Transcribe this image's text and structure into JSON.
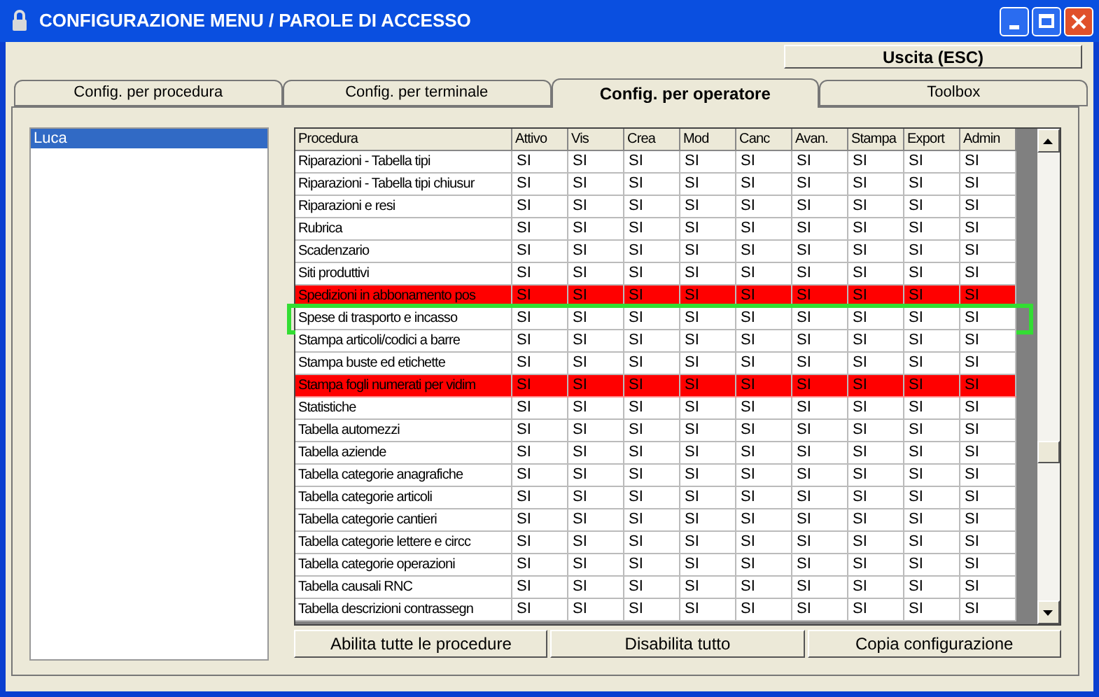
{
  "window": {
    "title": "CONFIGURAZIONE MENU / PAROLE DI ACCESSO"
  },
  "exit_button": "Uscita (ESC)",
  "tabs": [
    {
      "label": "Config. per procedura",
      "selected": false
    },
    {
      "label": "Config. per terminale",
      "selected": false
    },
    {
      "label": "Config. per operatore",
      "selected": true
    },
    {
      "label": "Toolbox",
      "selected": false
    }
  ],
  "operators": [
    {
      "name": "Luca",
      "selected": true
    }
  ],
  "table": {
    "columns": [
      "Procedura",
      "Attivo",
      "Vis",
      "Crea",
      "Mod",
      "Canc",
      "Avan.",
      "Stampa",
      "Export",
      "Admin"
    ],
    "rows": [
      {
        "cells": [
          "Riparazioni - Tabella tipi",
          "SI",
          "SI",
          "SI",
          "SI",
          "SI",
          "SI",
          "SI",
          "SI",
          "SI"
        ],
        "flagged": false,
        "selected": false
      },
      {
        "cells": [
          "Riparazioni - Tabella tipi chiusur",
          "SI",
          "SI",
          "SI",
          "SI",
          "SI",
          "SI",
          "SI",
          "SI",
          "SI"
        ],
        "flagged": false,
        "selected": false
      },
      {
        "cells": [
          "Riparazioni e resi",
          "SI",
          "SI",
          "SI",
          "SI",
          "SI",
          "SI",
          "SI",
          "SI",
          "SI"
        ],
        "flagged": false,
        "selected": false
      },
      {
        "cells": [
          "Rubrica",
          "SI",
          "SI",
          "SI",
          "SI",
          "SI",
          "SI",
          "SI",
          "SI",
          "SI"
        ],
        "flagged": false,
        "selected": false
      },
      {
        "cells": [
          "Scadenzario",
          "SI",
          "SI",
          "SI",
          "SI",
          "SI",
          "SI",
          "SI",
          "SI",
          "SI"
        ],
        "flagged": false,
        "selected": false
      },
      {
        "cells": [
          "Siti produttivi",
          "SI",
          "SI",
          "SI",
          "SI",
          "SI",
          "SI",
          "SI",
          "SI",
          "SI"
        ],
        "flagged": false,
        "selected": false
      },
      {
        "cells": [
          "Spedizioni in abbonamento pos",
          "SI",
          "SI",
          "SI",
          "SI",
          "SI",
          "SI",
          "SI",
          "SI",
          "SI"
        ],
        "flagged": true,
        "selected": false
      },
      {
        "cells": [
          "Spese di trasporto e incasso",
          "SI",
          "SI",
          "SI",
          "SI",
          "SI",
          "SI",
          "SI",
          "SI",
          "SI"
        ],
        "flagged": false,
        "selected": true
      },
      {
        "cells": [
          "Stampa articoli/codici a barre",
          "SI",
          "SI",
          "SI",
          "SI",
          "SI",
          "SI",
          "SI",
          "SI",
          "SI"
        ],
        "flagged": false,
        "selected": false
      },
      {
        "cells": [
          "Stampa buste ed etichette",
          "SI",
          "SI",
          "SI",
          "SI",
          "SI",
          "SI",
          "SI",
          "SI",
          "SI"
        ],
        "flagged": false,
        "selected": false
      },
      {
        "cells": [
          "Stampa fogli numerati per vidim",
          "SI",
          "SI",
          "SI",
          "SI",
          "SI",
          "SI",
          "SI",
          "SI",
          "SI"
        ],
        "flagged": true,
        "selected": false
      },
      {
        "cells": [
          "Statistiche",
          "SI",
          "SI",
          "SI",
          "SI",
          "SI",
          "SI",
          "SI",
          "SI",
          "SI"
        ],
        "flagged": false,
        "selected": false
      },
      {
        "cells": [
          "Tabella automezzi",
          "SI",
          "SI",
          "SI",
          "SI",
          "SI",
          "SI",
          "SI",
          "SI",
          "SI"
        ],
        "flagged": false,
        "selected": false
      },
      {
        "cells": [
          "Tabella aziende",
          "SI",
          "SI",
          "SI",
          "SI",
          "SI",
          "SI",
          "SI",
          "SI",
          "SI"
        ],
        "flagged": false,
        "selected": false
      },
      {
        "cells": [
          "Tabella categorie anagrafiche",
          "SI",
          "SI",
          "SI",
          "SI",
          "SI",
          "SI",
          "SI",
          "SI",
          "SI"
        ],
        "flagged": false,
        "selected": false
      },
      {
        "cells": [
          "Tabella categorie articoli",
          "SI",
          "SI",
          "SI",
          "SI",
          "SI",
          "SI",
          "SI",
          "SI",
          "SI"
        ],
        "flagged": false,
        "selected": false
      },
      {
        "cells": [
          "Tabella categorie cantieri",
          "SI",
          "SI",
          "SI",
          "SI",
          "SI",
          "SI",
          "SI",
          "SI",
          "SI"
        ],
        "flagged": false,
        "selected": false
      },
      {
        "cells": [
          "Tabella categorie lettere e circc",
          "SI",
          "SI",
          "SI",
          "SI",
          "SI",
          "SI",
          "SI",
          "SI",
          "SI"
        ],
        "flagged": false,
        "selected": false
      },
      {
        "cells": [
          "Tabella categorie operazioni",
          "SI",
          "SI",
          "SI",
          "SI",
          "SI",
          "SI",
          "SI",
          "SI",
          "SI"
        ],
        "flagged": false,
        "selected": false
      },
      {
        "cells": [
          "Tabella causali RNC",
          "SI",
          "SI",
          "SI",
          "SI",
          "SI",
          "SI",
          "SI",
          "SI",
          "SI"
        ],
        "flagged": false,
        "selected": false
      },
      {
        "cells": [
          "Tabella descrizioni contrassegn",
          "SI",
          "SI",
          "SI",
          "SI",
          "SI",
          "SI",
          "SI",
          "SI",
          "SI"
        ],
        "flagged": false,
        "selected": false
      }
    ]
  },
  "buttons": [
    "Abilita tutte le procedure",
    "Disabilita tutto",
    "Copia configurazione"
  ]
}
